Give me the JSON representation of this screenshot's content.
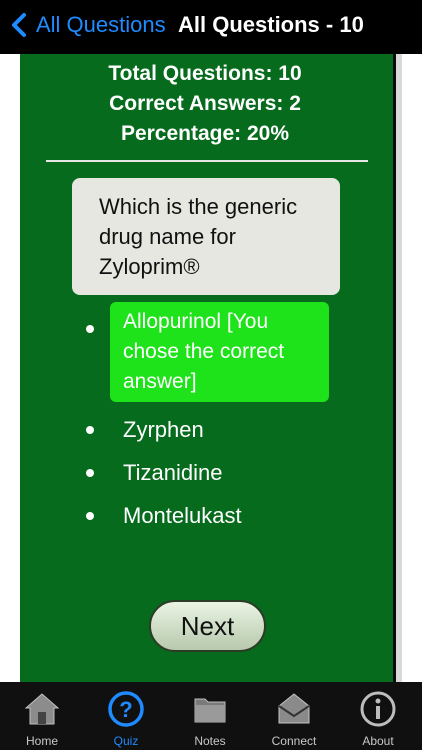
{
  "navbar": {
    "back_label": "All Questions",
    "title": "All Questions - 10"
  },
  "stats": {
    "total": "Total Questions: 10",
    "correct": "Correct Answers: 2",
    "percentage": "Percentage: 20%"
  },
  "question": {
    "text": "Which is the generic drug name for Zyloprim®"
  },
  "answers": [
    {
      "text": "Allopurinol [You chose the correct answer]",
      "state": "correct"
    },
    {
      "text": "Zyrphen",
      "state": "normal"
    },
    {
      "text": "Tizanidine",
      "state": "normal"
    },
    {
      "text": "Montelukast",
      "state": "normal"
    }
  ],
  "next_label": "Next",
  "tabbar": {
    "items": [
      {
        "label": "Home",
        "icon": "home-icon"
      },
      {
        "label": "Quiz",
        "icon": "quiz-icon",
        "active": true
      },
      {
        "label": "Notes",
        "icon": "folder-icon"
      },
      {
        "label": "Connect",
        "icon": "envelope-icon"
      },
      {
        "label": "About",
        "icon": "info-icon"
      }
    ]
  },
  "colors": {
    "accent": "#1f8bff",
    "card_green": "#066b1d",
    "correct_green": "#1ee21a"
  }
}
